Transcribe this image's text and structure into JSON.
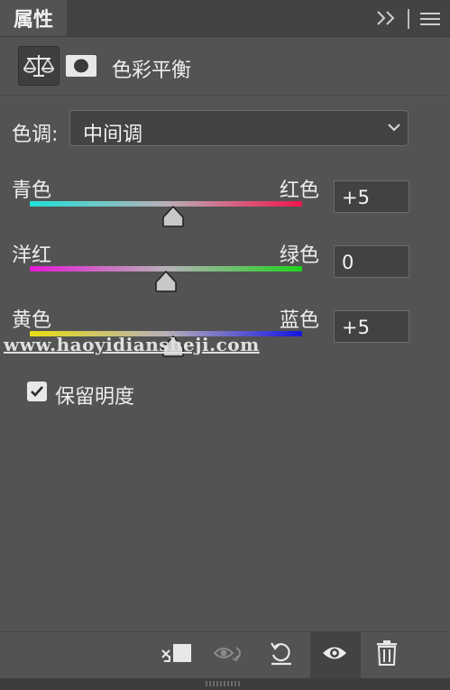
{
  "panel": {
    "tab_title": "属性",
    "adjustment_title": "色彩平衡"
  },
  "preset": {
    "label": "色调:",
    "selected": "中间调"
  },
  "sliders": [
    {
      "left_label": "青色",
      "right_label": "红色",
      "value": "+5",
      "position": 0.525,
      "gradient": [
        "#1ee0d8",
        "#b8b0b8",
        "#f0154c"
      ]
    },
    {
      "left_label": "洋红",
      "right_label": "绿色",
      "value": "0",
      "position": 0.5,
      "gradient": [
        "#e41ad2",
        "#b8b0b8",
        "#1ed21e"
      ]
    },
    {
      "left_label": "黄色",
      "right_label": "蓝色",
      "value": "+5",
      "position": 0.525,
      "gradient": [
        "#e8dc12",
        "#b8b0b8",
        "#1414e0"
      ]
    }
  ],
  "watermark": "www.haoyidiansheji.com",
  "preserve_luminosity": {
    "label": "保留明度",
    "checked": true
  },
  "icons": {
    "collapse": "double-chevron-right-icon",
    "menu": "hamburger-menu-icon",
    "adjustment": "balance-scale-icon",
    "mask": "mask-icon",
    "clip": "clip-to-layer-icon",
    "view_previous": "view-previous-state-icon",
    "reset": "reset-icon",
    "visibility": "eye-icon",
    "delete": "trash-icon"
  }
}
